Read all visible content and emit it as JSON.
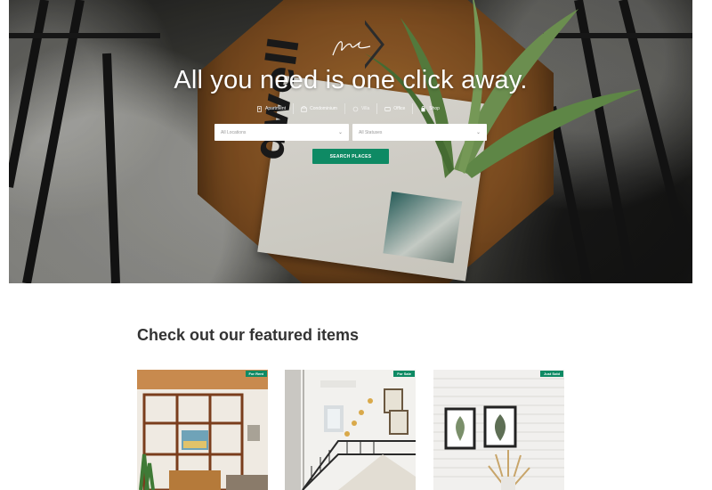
{
  "hero": {
    "title": "All you need is one click away.",
    "magazine_word": "dwell",
    "categories": [
      {
        "label": "Apartment",
        "icon": "building-icon"
      },
      {
        "label": "Condominium",
        "icon": "condo-icon"
      },
      {
        "label": "Villa",
        "icon": "villa-icon"
      },
      {
        "label": "Office",
        "icon": "office-icon"
      },
      {
        "label": "Shop",
        "icon": "shop-icon"
      }
    ],
    "location_select": "All Locations",
    "status_select": "All Statuses",
    "search_button": "SEARCH PLACES"
  },
  "featured": {
    "title": "Check out our featured items",
    "items": [
      {
        "badge": "For Rent"
      },
      {
        "badge": "For Sale"
      },
      {
        "badge": "Just Sold"
      }
    ]
  },
  "colors": {
    "accent": "#0e8a64",
    "title_text": "#333333"
  }
}
